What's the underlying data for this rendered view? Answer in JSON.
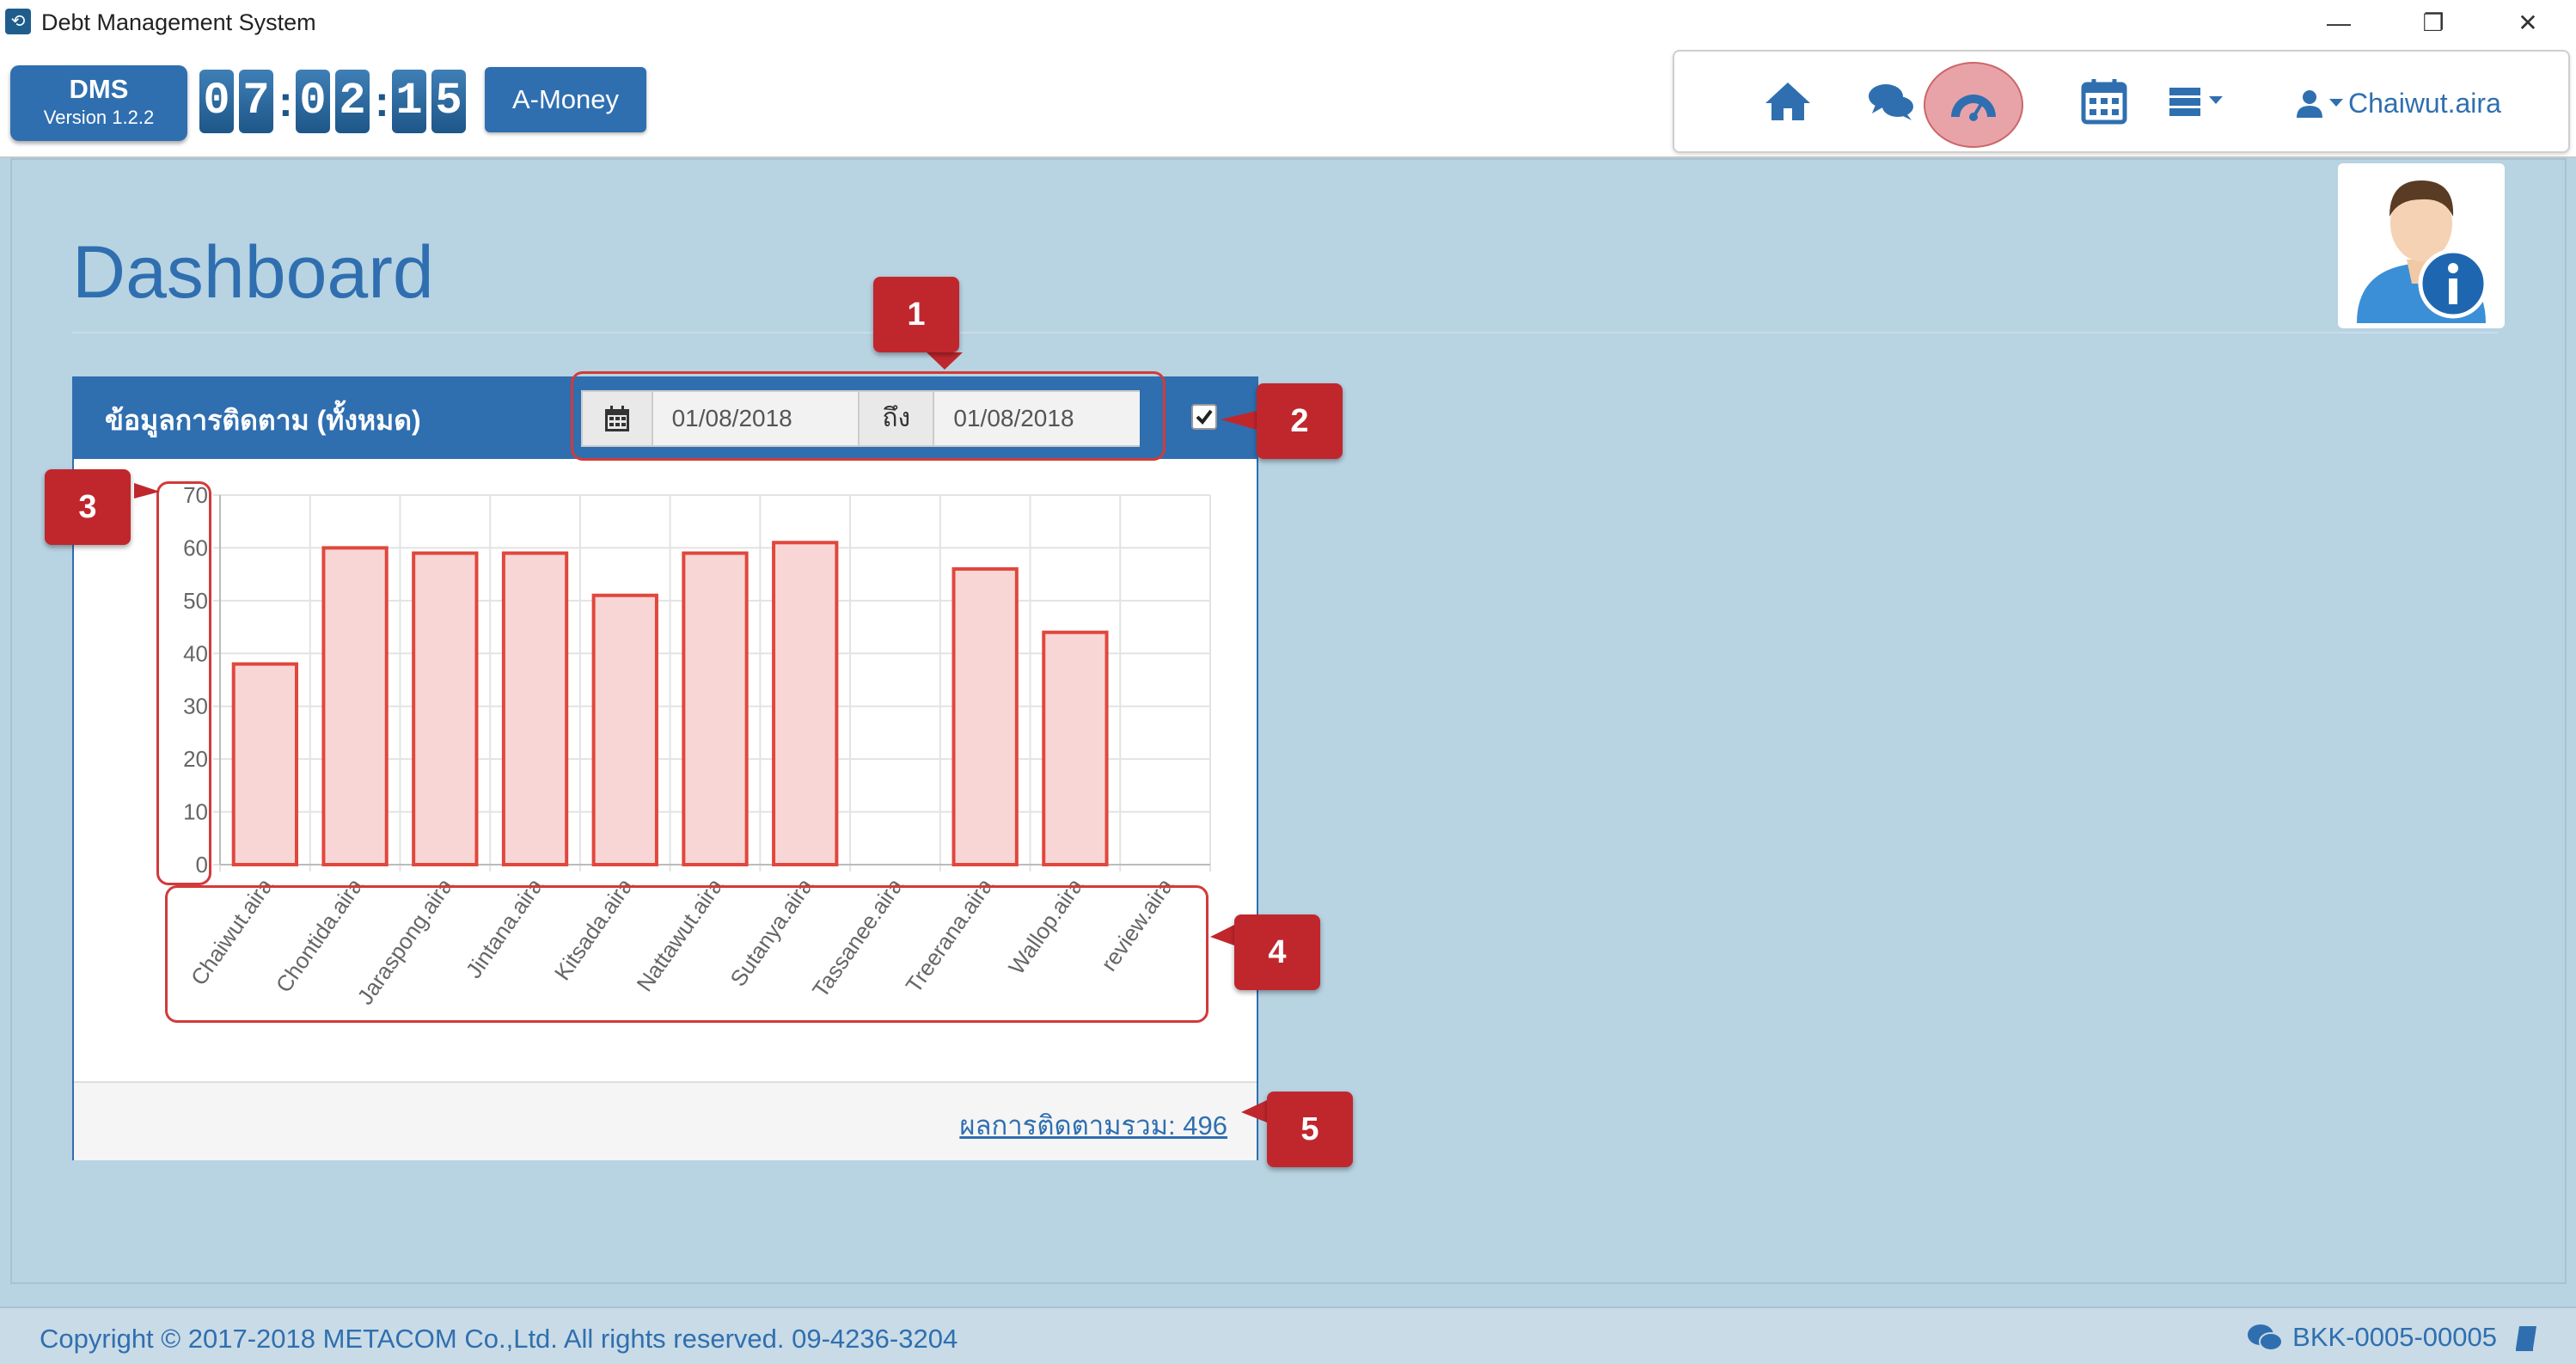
{
  "window": {
    "title": "Debt Management System"
  },
  "header": {
    "app_name": "DMS",
    "version": "Version 1.2.2",
    "clock_digits": [
      "0",
      "7",
      "0",
      "2",
      "1",
      "5"
    ],
    "amoney_label": "A-Money",
    "username": "Chaiwut.aira"
  },
  "page": {
    "title": "Dashboard"
  },
  "panel": {
    "title": "ข้อมูลการติดตาม (ทั้งหมด)",
    "date_from": "01/08/2018",
    "date_to_label": "ถึง",
    "date_to": "01/08/2018",
    "checkbox_checked": true,
    "total_label": "ผลการติดตามรวม: 496"
  },
  "callouts": [
    "1",
    "2",
    "3",
    "4",
    "5"
  ],
  "chart_data": {
    "type": "bar",
    "categories": [
      "Chaiwut.aira",
      "Chontida.aira",
      "Jaraspong.aira",
      "Jintana.aira",
      "Kitsada.aira",
      "Nattawut.aira",
      "Sutanya.aira",
      "Tassanee.aira",
      "Treerana.aira",
      "Wallop.aira",
      "review.aira"
    ],
    "values": [
      38,
      60,
      59,
      59,
      51,
      59,
      61,
      0,
      56,
      44,
      0
    ],
    "ylim": [
      0,
      70
    ],
    "yticks": [
      0,
      10,
      20,
      30,
      40,
      50,
      60,
      70
    ],
    "bar_fill": "#f9d6d6",
    "bar_stroke": "#e0473d",
    "grid": true
  },
  "footer": {
    "copyright": "Copyright © 2017-2018 METACOM Co.,Ltd. All rights reserved. 09-4236-3204",
    "code": "BKK-0005-00005"
  },
  "colors": {
    "primary": "#2f6fb0",
    "background": "#b8d3e2",
    "callout": "#c0272d"
  }
}
